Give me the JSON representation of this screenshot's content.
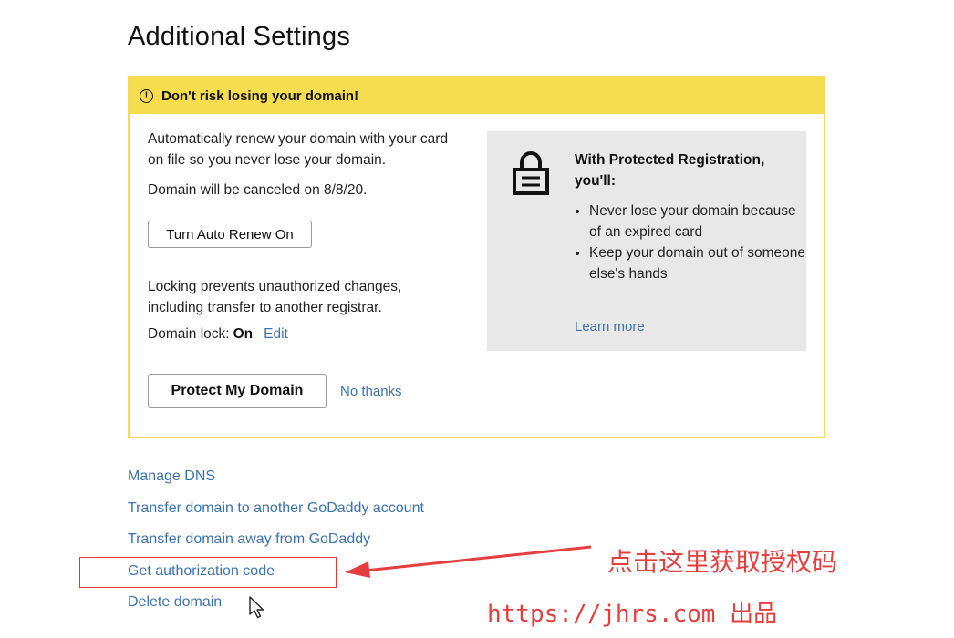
{
  "page": {
    "title": "Additional Settings"
  },
  "warning": {
    "header": "Don't risk losing your domain!",
    "auto_renew_text": "Automatically renew your domain with your card on file so you never lose your domain.",
    "cancel_text": "Domain will be canceled on 8/8/20.",
    "auto_renew_button": "Turn Auto Renew On",
    "locking_text": "Locking prevents unauthorized changes, including transfer to another registrar.",
    "lock_label": "Domain lock:",
    "lock_value": "On",
    "edit_label": "Edit",
    "protect_button": "Protect My Domain",
    "no_thanks": "No thanks",
    "promo": {
      "title": "With Protected Registration, you'll:",
      "bullets": [
        "Never lose your domain because of an expired card",
        "Keep your domain out of someone else's hands"
      ],
      "learn_more": "Learn more"
    }
  },
  "links": [
    "Manage DNS",
    "Transfer domain to another GoDaddy account",
    "Transfer domain away from GoDaddy",
    "Get authorization code",
    "Delete domain"
  ],
  "annotation": {
    "text": "点击这里获取授权码",
    "watermark": "https://jhrs.com 出品",
    "color": "#e53e3e"
  },
  "colors": {
    "accent_yellow": "#f6dd4f",
    "link_blue": "#3b73af"
  },
  "icons": [
    "info-icon",
    "lock-icon",
    "mouse-cursor-icon",
    "red-arrow-icon"
  ]
}
